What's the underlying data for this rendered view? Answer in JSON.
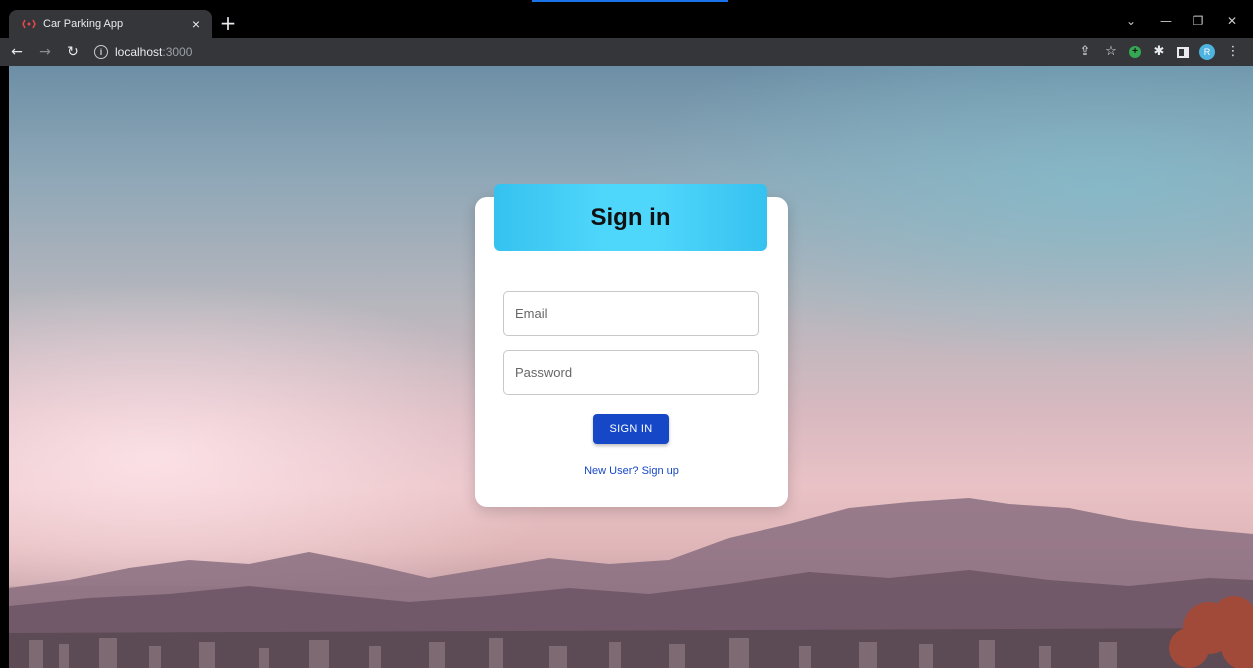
{
  "browser": {
    "tab_title": "Car Parking App",
    "tab_close": "×",
    "new_tab": "+",
    "url_host": "localhost",
    "url_port": ":3000",
    "profile_initial": "R",
    "window_controls": {
      "dropdown": "⌄",
      "minimize": "—",
      "restore": "❐",
      "close": "✕"
    },
    "accent_color": "#1a73e8"
  },
  "signin": {
    "title": "Sign in",
    "email_placeholder": "Email",
    "password_placeholder": "Password",
    "submit_label": "SIGN IN",
    "signup_link": "New User? Sign up",
    "header_color": "#4fd6fb",
    "button_color": "#1547c7"
  }
}
